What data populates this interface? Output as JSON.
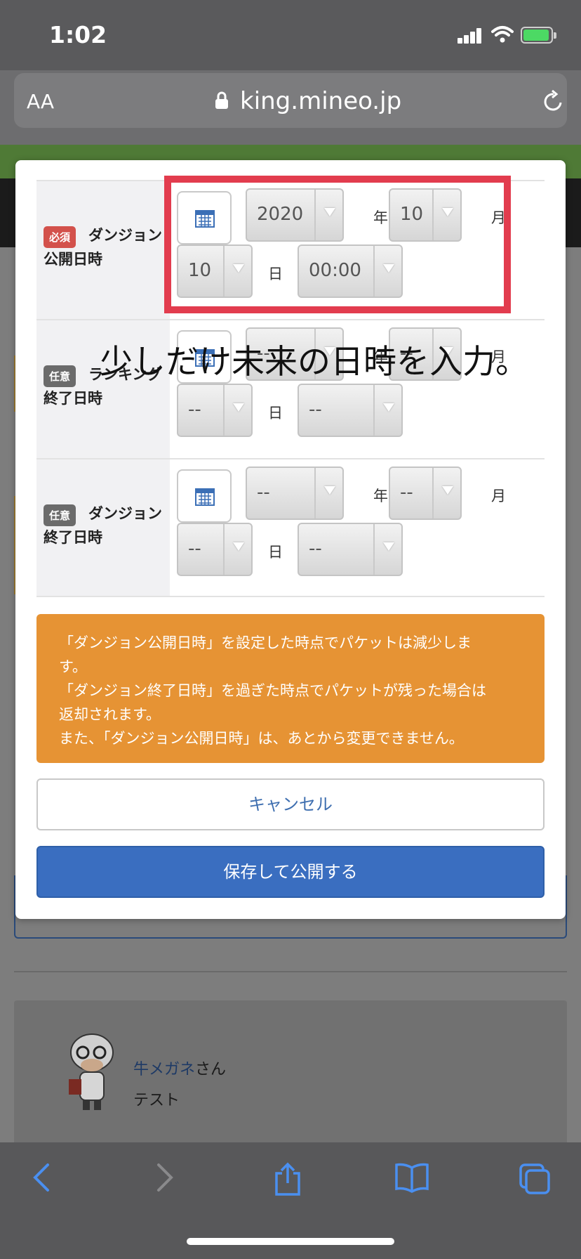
{
  "status_bar": {
    "time": "1:02"
  },
  "browser": {
    "text_size": "AA",
    "host": "king.mineo.jp"
  },
  "form": {
    "rows": [
      {
        "badge": "必須",
        "label": "ダンジョン公開日時",
        "year": "2020",
        "month": "10",
        "day": "10",
        "time": "00:00"
      },
      {
        "badge": "任意",
        "label": "ランキング終了日時",
        "year": "--",
        "month": "--",
        "day": "--",
        "time": "--"
      },
      {
        "badge": "任意",
        "label": "ダンジョン終了日時",
        "year": "--",
        "month": "--",
        "day": "--",
        "time": "--"
      }
    ],
    "units": {
      "year": "年",
      "month": "月",
      "day": "日"
    }
  },
  "overlay_caption": "少しだけ未来の日時を入力。",
  "notice": {
    "line1": "「ダンジョン公開日時」を設定した時点でパケットは減少しま",
    "line2": "す。",
    "line3": "「ダンジョン終了日時」を過ぎた時点でパケットが残った場合は",
    "line4": "返却されます。",
    "line5": "また、「ダンジョン公開日時」は、あとから変更できません。"
  },
  "buttons": {
    "cancel": "キャンセル",
    "save": "保存して公開する"
  },
  "comment": {
    "author": "牛メガネ",
    "honorific": "さん",
    "text": "テスト"
  },
  "colors": {
    "required_badge": "#d3514b",
    "optional_badge": "#6b6b6b",
    "notice_bg": "#e69334",
    "save_button": "#3a6ec0",
    "highlight": "#e23c4e"
  }
}
